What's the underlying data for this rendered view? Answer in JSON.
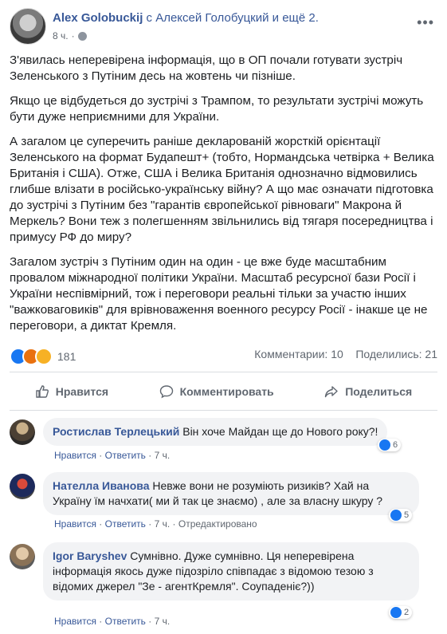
{
  "post": {
    "author": "Alex Golobuckij",
    "with_text": "с Алексей Голобуцкий и ещё 2.",
    "time": "8 ч.",
    "paragraphs": [
      "З'явилась неперевірена інформація, що в ОП почали готувати зустріч Зеленського з Путіним десь на жовтень чи пізніше.",
      "Якщо це відбудеться до зустрічі з Трампом, то результати зустрічі можуть бути дуже неприємними для України.",
      "А загалом це суперечить раніше декларованій жорсткій орієнтації Зеленського на формат Будапешт+ (тобто, Нормандська четвірка + Велика Британія і США). Отже, США і Велика Британія однозначно відмовились глибше влізати в російсько-українську війну? А що має означати підготовка до зустрічі з Путіним без \"гарантів європейської рівноваги\" Макрона й Меркель? Вони теж з полегшенням звільнились від тягаря посередництва і примусу РФ до миру?",
      "Загалом зустріч з Путіним один на один - це вже буде масштабним провалом міжнародної політики України. Масштаб ресурсної бази Росії і України неспівмірний, тож і переговори реальні тільки за участю інших \"важковаговиків\" для врівноваження военного ресурсу Росії - інакше це не переговори, а диктат Кремля."
    ],
    "reaction_count": "181",
    "comments_count": "Комментарии: 10",
    "shares_count": "Поделились: 21"
  },
  "actions": {
    "like": "Нравится",
    "comment": "Комментировать",
    "share": "Поделиться"
  },
  "comments": [
    {
      "name": "Ростислав Терлецький",
      "text": "Він хоче Майдан ще до Нового року?!",
      "likes": "6",
      "like_label": "Нравится",
      "reply_label": "Ответить",
      "time": "7 ч.",
      "edited": ""
    },
    {
      "name": "Нателла Иванова",
      "text": "Невже вони не розуміють ризиків? Хай на Україну їм начхати( ми й так це знаємо) , але за власну шкуру ?",
      "likes": "5",
      "like_label": "Нравится",
      "reply_label": "Ответить",
      "time": "7 ч.",
      "edited": "Отредактировано"
    },
    {
      "name": "Igor Baryshev",
      "text": "Сумнівно. Дуже сумнівно. Ця неперевірена інформація якось дуже підозріло співпадає з відомою тезою з відомих джерел \"Зе - агентКремля\". Соупаденіє?))",
      "likes": "2",
      "like_label": "Нравится",
      "reply_label": "Ответить",
      "time": "7 ч.",
      "edited": ""
    }
  ],
  "colors": {
    "link": "#385898",
    "like_blue": "#1877f2",
    "bubble": "#f2f3f5",
    "muted": "#606770"
  }
}
